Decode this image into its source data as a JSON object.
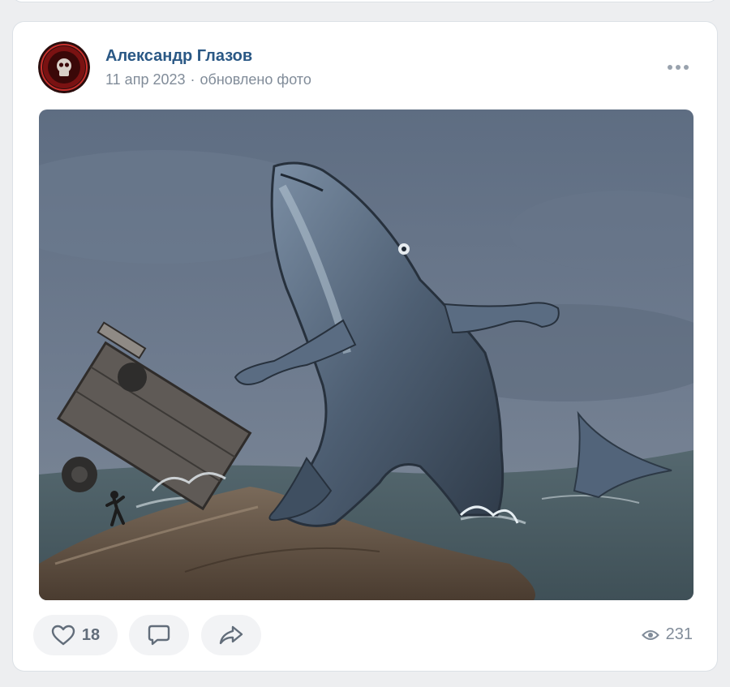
{
  "post": {
    "author": "Александр Глазов",
    "date": "11 апр 2023",
    "separator": "·",
    "action": "обновлено фото"
  },
  "footer": {
    "likes": "18",
    "views": "231"
  },
  "icons": {
    "more": "more-dots-icon",
    "like": "heart-icon",
    "comment": "comment-icon",
    "share": "share-icon",
    "views": "eye-icon"
  },
  "colors": {
    "author_link": "#2a5885",
    "meta_text": "#818c99",
    "button_bg": "#f2f3f5",
    "page_bg": "#edeef0"
  }
}
